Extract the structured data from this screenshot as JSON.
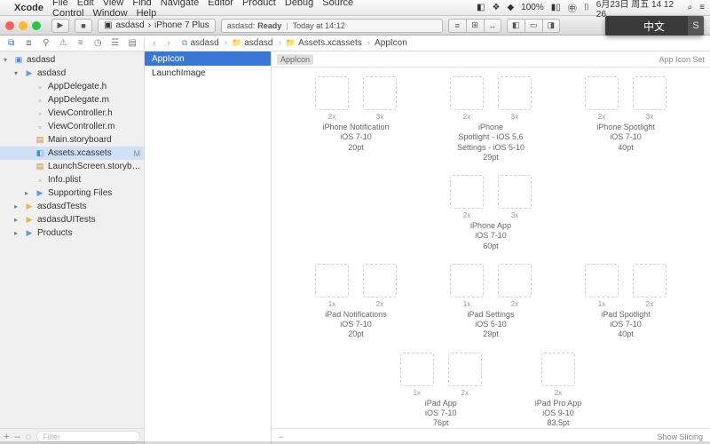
{
  "menubar": {
    "app": "Xcode",
    "items": [
      "File",
      "Edit",
      "View",
      "Find",
      "Navigate",
      "Editor",
      "Product",
      "Debug",
      "Source Control",
      "Window",
      "Help"
    ],
    "status": {
      "battery": "100%",
      "charging": "⚡",
      "ime_flag": "㊥",
      "lang": "☰",
      "date": "6月23日 周五 14 12 26",
      "icons": [
        "◧",
        "✿",
        "◆",
        "↯",
        "✽",
        "≙",
        "☁"
      ]
    }
  },
  "toolbar": {
    "run": "▶",
    "stop": "■",
    "scheme_app": "asdasd",
    "scheme_sep": "›",
    "scheme_dest": "iPhone 7 Plus",
    "activity_proj": "asdasd:",
    "activity_status": "Ready",
    "activity_time": "Today at 14:12",
    "editor_icons": [
      "≡",
      "⊞",
      "↔"
    ],
    "panel_icons": [
      "◧",
      "▭",
      "◨"
    ]
  },
  "ime": {
    "text": "中文",
    "side": "S"
  },
  "navigators": [
    "⧉",
    "⧈",
    "⚲",
    "⚠",
    "≡",
    "◷",
    "☰",
    "▤"
  ],
  "jump": {
    "back": "‹",
    "fwd": "›",
    "crumbs": [
      {
        "icon": "⧉",
        "label": "asdasd"
      },
      {
        "icon": "📁",
        "label": "asdasd"
      },
      {
        "icon": "📁",
        "label": "Assets.xcassets"
      },
      {
        "icon": "",
        "label": "AppIcon"
      }
    ]
  },
  "tree": [
    {
      "d": 0,
      "disc": "▾",
      "ic": "proj",
      "label": "asdasd"
    },
    {
      "d": 1,
      "disc": "▾",
      "ic": "fold",
      "label": "asdasd"
    },
    {
      "d": 2,
      "disc": "",
      "ic": "file",
      "label": "AppDelegate.h"
    },
    {
      "d": 2,
      "disc": "",
      "ic": "file",
      "label": "AppDelegate.m"
    },
    {
      "d": 2,
      "disc": "",
      "ic": "file",
      "label": "ViewController.h"
    },
    {
      "d": 2,
      "disc": "",
      "ic": "file",
      "label": "ViewController.m"
    },
    {
      "d": 2,
      "disc": "",
      "ic": "sb",
      "label": "Main.storyboard"
    },
    {
      "d": 2,
      "disc": "",
      "ic": "xc",
      "label": "Assets.xcassets",
      "sel": true,
      "mod": "M"
    },
    {
      "d": 2,
      "disc": "",
      "ic": "sb",
      "label": "LaunchScreen.storyboard"
    },
    {
      "d": 2,
      "disc": "",
      "ic": "file",
      "label": "Info.plist"
    },
    {
      "d": 2,
      "disc": "▸",
      "ic": "fold",
      "label": "Supporting Files"
    },
    {
      "d": 1,
      "disc": "▸",
      "ic": "yfold",
      "label": "asdasdTests"
    },
    {
      "d": 1,
      "disc": "▸",
      "ic": "yfold",
      "label": "asdasdUITests"
    },
    {
      "d": 1,
      "disc": "▸",
      "ic": "fold",
      "label": "Products"
    }
  ],
  "navbottom": {
    "add": "+",
    "remove": "–",
    "filter_placeholder": "Filter"
  },
  "outline": [
    {
      "label": "AppIcon",
      "sel": true
    },
    {
      "label": "LaunchImage"
    }
  ],
  "canvas": {
    "crumb": "AppIcon",
    "type": "App Icon Set",
    "show_slicing": "Show Slicing",
    "bottom_icons": [
      "−",
      "+",
      "⊞"
    ]
  },
  "icon_groups": [
    {
      "row": 1,
      "scales": [
        "2x",
        "3x"
      ],
      "title": "iPhone Notification",
      "sub": "iOS 7-10",
      "pt": "20pt"
    },
    {
      "row": 1,
      "scales": [
        "2x",
        "3x"
      ],
      "title": "iPhone",
      "sub": "Spotlight - iOS 5,6",
      "sub2": "Settings - iOS 5-10",
      "pt": "29pt"
    },
    {
      "row": 1,
      "scales": [
        "2x",
        "3x"
      ],
      "title": "iPhone Spotlight",
      "sub": "iOS 7-10",
      "pt": "40pt"
    },
    {
      "row": 2,
      "scales": [
        "2x",
        "3x"
      ],
      "title": "iPhone App",
      "sub": "iOS 7-10",
      "pt": "60pt"
    },
    {
      "row": 3,
      "scales": [
        "1x",
        "2x"
      ],
      "title": "iPad Notifications",
      "sub": "iOS 7-10",
      "pt": "20pt"
    },
    {
      "row": 3,
      "scales": [
        "1x",
        "2x"
      ],
      "title": "iPad Settings",
      "sub": "iOS 5-10",
      "pt": "29pt"
    },
    {
      "row": 3,
      "scales": [
        "1x",
        "2x"
      ],
      "title": "iPad Spotlight",
      "sub": "iOS 7-10",
      "pt": "40pt"
    },
    {
      "row": 4,
      "scales": [
        "1x",
        "2x"
      ],
      "title": "iPad App",
      "sub": "iOS 7-10",
      "pt": "76pt"
    },
    {
      "row": 4,
      "scales": [
        "2x"
      ],
      "title": "iPad Pro App",
      "sub": "iOS 9-10",
      "pt": "83.5pt"
    }
  ]
}
